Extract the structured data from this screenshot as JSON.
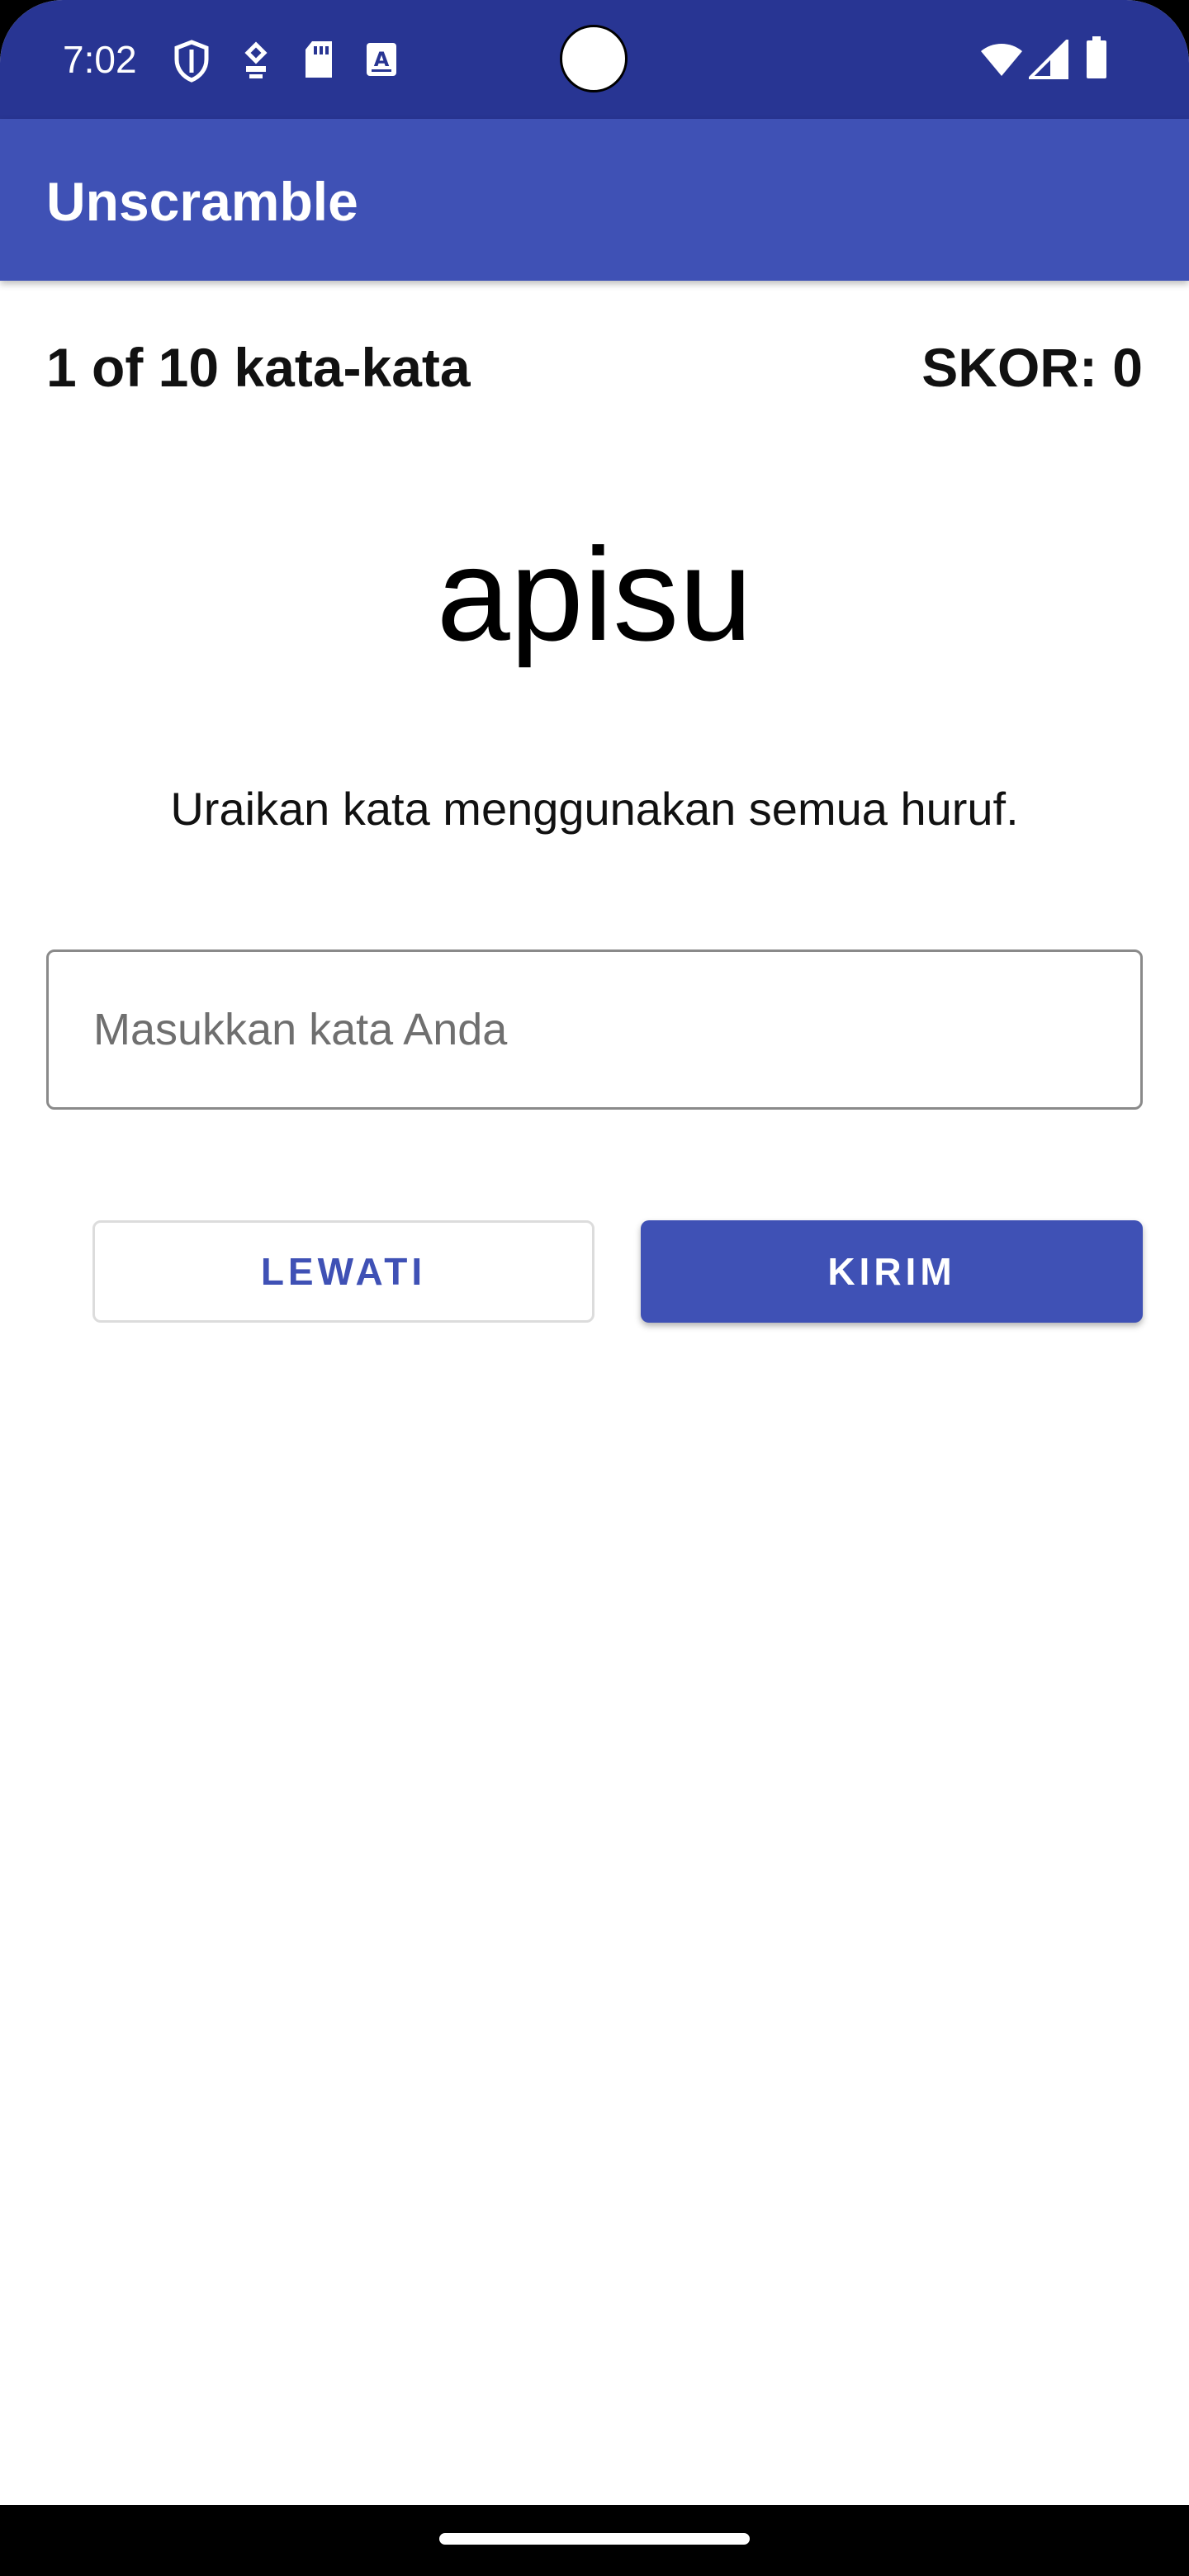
{
  "status_bar": {
    "time": "7:02",
    "left_icons": [
      "shield-icon",
      "vpn-key-icon",
      "sd-card-icon",
      "font-a-icon"
    ],
    "right_icons": [
      "wifi-icon",
      "cell-signal-icon",
      "battery-icon"
    ],
    "background_color": "#283593"
  },
  "app_bar": {
    "title": "Unscramble",
    "background_color": "#3f51b5"
  },
  "game": {
    "word_count": "1 of 10 kata-kata",
    "score": "SKOR: 0",
    "scrambled_word": "apisu",
    "instructions": "Uraikan kata menggunakan semua huruf."
  },
  "answer_input": {
    "value": "",
    "placeholder": "Masukkan kata Anda"
  },
  "buttons": {
    "skip_label": "LEWATI",
    "submit_label": "KIRIM",
    "accent_color": "#3f51b5"
  }
}
